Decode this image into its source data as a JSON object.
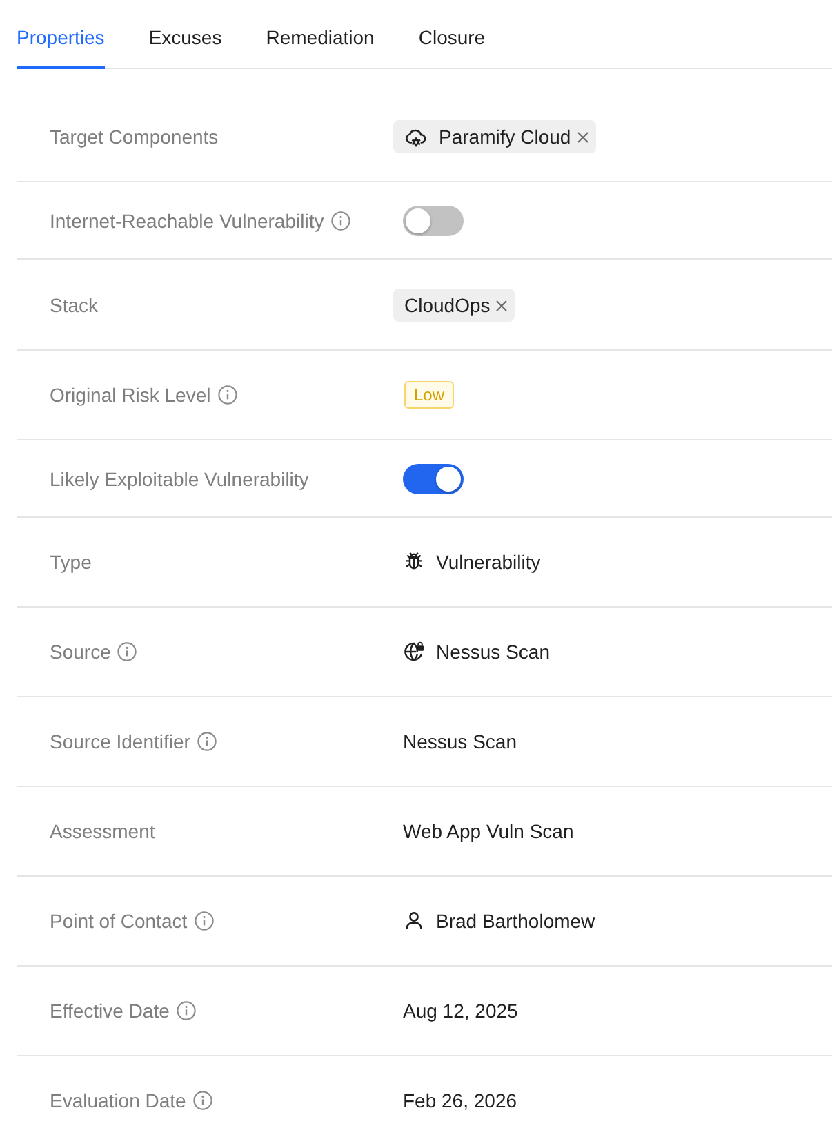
{
  "tabs": [
    {
      "label": "Properties",
      "selected": true
    },
    {
      "label": "Excuses",
      "selected": false
    },
    {
      "label": "Remediation",
      "selected": false
    },
    {
      "label": "Closure",
      "selected": false
    }
  ],
  "properties": [
    {
      "label": "Target Components",
      "info": false,
      "kind": "components",
      "tags": [
        "Paramify Cloud"
      ]
    },
    {
      "label": "Internet-Reachable Vulnerability",
      "info": true,
      "kind": "toggle",
      "on": false
    },
    {
      "label": "Stack",
      "info": false,
      "kind": "tags",
      "tags": [
        "CloudOps"
      ]
    },
    {
      "label": "Original Risk Level",
      "info": true,
      "kind": "badge",
      "value": "Low"
    },
    {
      "label": "Likely Exploitable Vulnerability",
      "info": false,
      "kind": "toggle",
      "on": true
    },
    {
      "label": "Type",
      "info": false,
      "kind": "type",
      "value": "Vulnerability"
    },
    {
      "label": "Source",
      "info": true,
      "kind": "source",
      "value": "Nessus Scan"
    },
    {
      "label": "Source Identifier",
      "info": true,
      "kind": "text",
      "value": "Nessus Scan"
    },
    {
      "label": "Assessment",
      "info": false,
      "kind": "text",
      "value": "Web App Vuln Scan"
    },
    {
      "label": "Point of Contact",
      "info": true,
      "kind": "contact",
      "value": "Brad Bartholomew"
    },
    {
      "label": "Effective Date",
      "info": true,
      "kind": "text",
      "value": "Aug 12, 2025"
    },
    {
      "label": "Evaluation Date",
      "info": true,
      "kind": "text",
      "value": "Feb 26, 2026"
    }
  ]
}
